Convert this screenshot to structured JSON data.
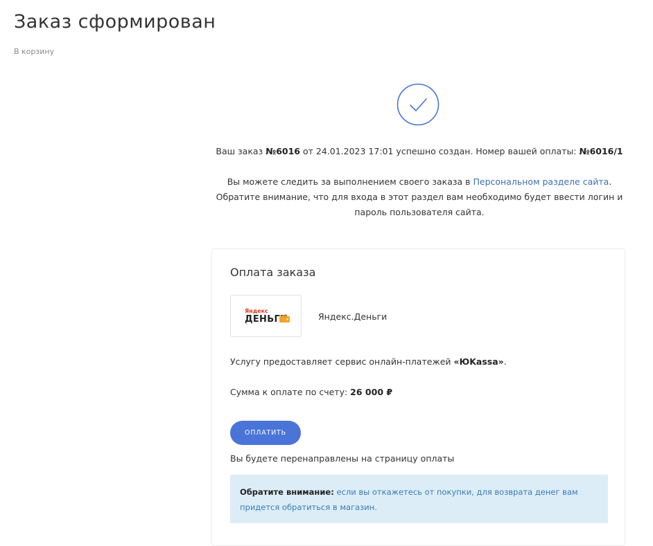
{
  "page": {
    "title": "Заказ сформирован",
    "breadcrumb": "В корзину"
  },
  "order": {
    "created_prefix": "Ваш заказ ",
    "order_number": "№6016",
    "created_middle": " от 24.01.2023 17:01 успешно создан. Номер вашей оплаты: ",
    "payment_number": "№6016/1",
    "track_text": "Вы можете следить за выполнением своего заказа в ",
    "track_link": "Персональном разделе сайта",
    "track_end": ".",
    "login_line1": "Обратите внимание, что для входа в этот раздел вам необходимо будет ввести логин и",
    "login_line2": "пароль пользователя сайта."
  },
  "payment": {
    "title": "Оплата заказа",
    "logo_small": "Яндекс",
    "logo_big": "ДЕНЬГИ",
    "method_name": "Яндекс.Деньги",
    "service_text": "Услугу предоставляет сервис онлайн-платежей ",
    "service_name": "«ЮKassa»",
    "service_end": ".",
    "sum_label": "Сумма к оплате по счету: ",
    "sum_value": "26 000 ₽",
    "pay_button": "ОПЛАТИТЬ",
    "redirect_text": "Вы будете перенаправлены на страницу оплаты",
    "notice_label": "Обратите внимание:",
    "notice_text": " если вы откажетесь от покупки, для возврата денег вам придется обратиться в магазин."
  },
  "colors": {
    "accent": "#4a74d8",
    "link": "#3b6fb6",
    "notice_bg": "#dcedf7",
    "yandex_red": "#d93a1b",
    "wallet_orange": "#f0a32a"
  }
}
